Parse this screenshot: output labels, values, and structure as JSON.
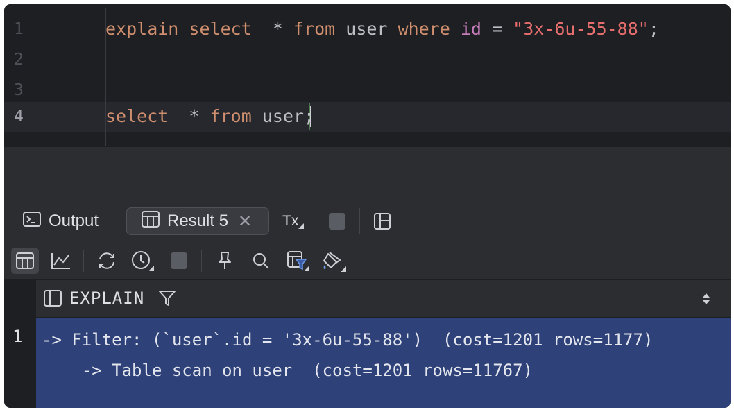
{
  "editor": {
    "lines": [
      {
        "number": "1"
      },
      {
        "number": "2"
      },
      {
        "number": "3"
      },
      {
        "number": "4"
      }
    ],
    "line1": {
      "t1": "explain",
      "t2": "select",
      "t3": "*",
      "t4": "from",
      "t5": "user",
      "t6": "where",
      "t7": "id",
      "t8": "=",
      "t9": "\"3x-6u-55-88\"",
      "t10": ";"
    },
    "line4": {
      "t1": "select",
      "t2": "*",
      "t3": "from",
      "t4": "user",
      "t5": ";"
    }
  },
  "tabs": {
    "output_label": "Output",
    "result_label": "Result 5",
    "tx_label": "Tx"
  },
  "results": {
    "column_header": "EXPLAIN",
    "row_number": "1",
    "explain_text": "-> Filter: (`user`.id = '3x-6u-55-88')  (cost=1201 rows=1177)\n    -> Table scan on user  (cost=1201 rows=11767)"
  },
  "icons": {
    "output": "terminal-icon",
    "result": "table-icon",
    "tx": "transaction-mode-icon",
    "stop": "stop-icon",
    "layout": "layout-icon",
    "table_view": "table-view-icon",
    "chart_view": "chart-view-icon",
    "refresh": "refresh-icon",
    "history": "clock-icon",
    "pin": "pin-icon",
    "search": "search-icon",
    "filter_table": "table-filter-icon",
    "paint": "paint-bucket-icon",
    "panel": "panel-icon",
    "column_filter": "filter-icon",
    "sort": "sort-icon"
  },
  "colors": {
    "keyword": "#cf8e6d",
    "identifier": "#c77dbb",
    "string": "#e76e6e",
    "selection_row": "#2e4178",
    "editor_bg": "#1e1f22",
    "panel_bg": "#2b2d30"
  }
}
